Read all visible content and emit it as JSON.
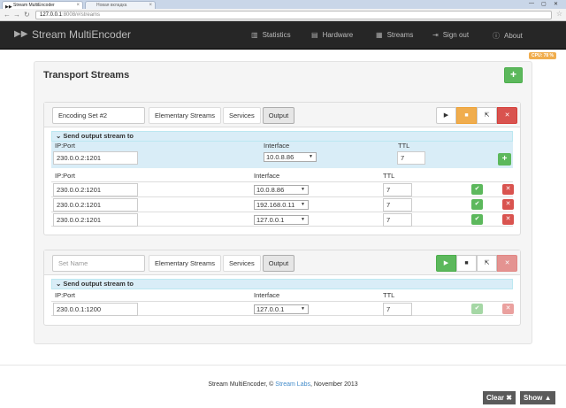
{
  "browser": {
    "tabs": [
      {
        "label": "Stream MultiEncoder"
      },
      {
        "label": "Новая вкладка"
      }
    ],
    "url_host": "127.0.0.1",
    "url_path": ":8008/#/streams"
  },
  "navbar": {
    "brand": "Stream MultiEncoder",
    "items": [
      {
        "label": "Statistics",
        "icon": "bar-chart-icon"
      },
      {
        "label": "Hardware",
        "icon": "hdd-icon"
      },
      {
        "label": "Streams",
        "icon": "film-icon"
      },
      {
        "label": "Sign out",
        "icon": "log-out-icon"
      },
      {
        "label": "About",
        "icon": "info-icon"
      }
    ]
  },
  "cpu_badge": "CPU: 78 %",
  "panel": {
    "title": "Transport Streams"
  },
  "sets": [
    {
      "name_value": "Encoding Set #2",
      "tabs": [
        "Elementary Streams",
        "Services",
        "Output"
      ],
      "active_tab": "Output",
      "section_label": "Send output stream to",
      "new_row": {
        "labels": {
          "ipport": "IP:Port",
          "interface": "Interface",
          "ttl": "TTL"
        },
        "ipport": "230.0.0.2:1201",
        "interface": "10.0.8.86",
        "ttl": "7"
      },
      "headers": {
        "ipport": "IP:Port",
        "interface": "Interface",
        "ttl": "TTL"
      },
      "rows": [
        {
          "ipport": "230.0.0.2:1201",
          "interface": "10.0.8.86",
          "ttl": "7"
        },
        {
          "ipport": "230.0.0.2:1201",
          "interface": "192.168.0.11",
          "ttl": "7"
        },
        {
          "ipport": "230.0.0.2:1201",
          "interface": "127.0.0.1",
          "ttl": "7"
        }
      ]
    },
    {
      "name_placeholder": "Set Name",
      "tabs": [
        "Elementary Streams",
        "Services",
        "Output"
      ],
      "active_tab": "Output",
      "section_label": "Send output stream to",
      "headers": {
        "ipport": "IP:Port",
        "interface": "Interface",
        "ttl": "TTL"
      },
      "rows": [
        {
          "ipport": "230.0.0.1:1200",
          "interface": "127.0.0.1",
          "ttl": "7"
        }
      ]
    }
  ],
  "footer": {
    "prefix": "Stream MultiEncoder, ©",
    "link": "Stream Labs",
    "suffix": ", November 2013"
  },
  "debug": {
    "clear": "Clear",
    "show": "Show"
  },
  "colors": {
    "navbar": "#262626",
    "success": "#5cb85c",
    "warning": "#f0ad4e",
    "danger": "#d9534f",
    "info_bg": "#d9edf7"
  }
}
